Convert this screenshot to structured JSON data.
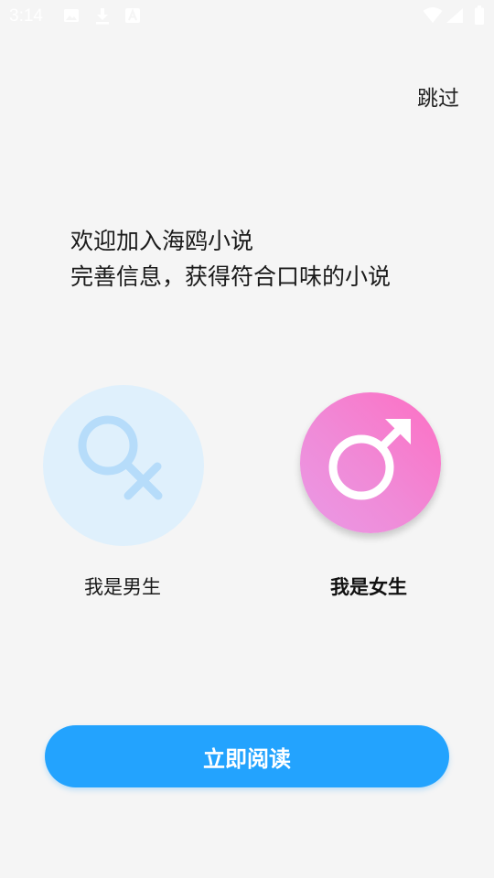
{
  "status_bar": {
    "time": "3:14"
  },
  "header": {
    "skip_label": "跳过"
  },
  "welcome": {
    "line1": "欢迎加入海鸥小说",
    "line2": "完善信息，获得符合口味的小说"
  },
  "gender": {
    "male_label": "我是男生",
    "female_label": "我是女生",
    "selected": "female"
  },
  "actions": {
    "read_now_label": "立即阅读"
  },
  "colors": {
    "background": "#f5f5f5",
    "primary_button": "#23a3fe",
    "male_circle": "#dff0fc",
    "male_icon": "#b6dcfa",
    "female_gradient_start": "#fd6fc3",
    "female_gradient_end": "#ea9ae6"
  }
}
